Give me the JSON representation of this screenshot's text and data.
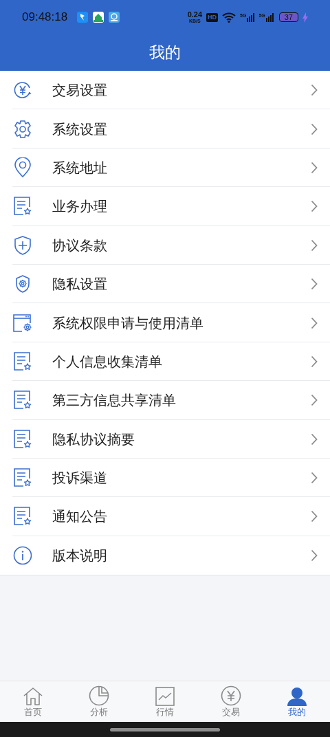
{
  "status_bar": {
    "time": "09:48:18",
    "speed_value": "0.24",
    "speed_unit": "KB/S",
    "hd": "HD",
    "signals": [
      "5G",
      "5G"
    ],
    "battery": "37"
  },
  "header": {
    "title": "我的"
  },
  "menu": [
    {
      "label": "交易设置"
    },
    {
      "label": "系统设置"
    },
    {
      "label": "系统地址"
    },
    {
      "label": "业务办理"
    },
    {
      "label": "协议条款"
    },
    {
      "label": "隐私设置"
    },
    {
      "label": "系统权限申请与使用清单"
    },
    {
      "label": "个人信息收集清单"
    },
    {
      "label": "第三方信息共享清单"
    },
    {
      "label": "隐私协议摘要"
    },
    {
      "label": "投诉渠道"
    },
    {
      "label": "通知公告"
    },
    {
      "label": "版本说明"
    }
  ],
  "tab_bar": [
    {
      "label": "首页",
      "selected": false
    },
    {
      "label": "分析",
      "selected": false
    },
    {
      "label": "行情",
      "selected": false
    },
    {
      "label": "交易",
      "selected": false
    },
    {
      "label": "我的",
      "selected": true
    }
  ]
}
